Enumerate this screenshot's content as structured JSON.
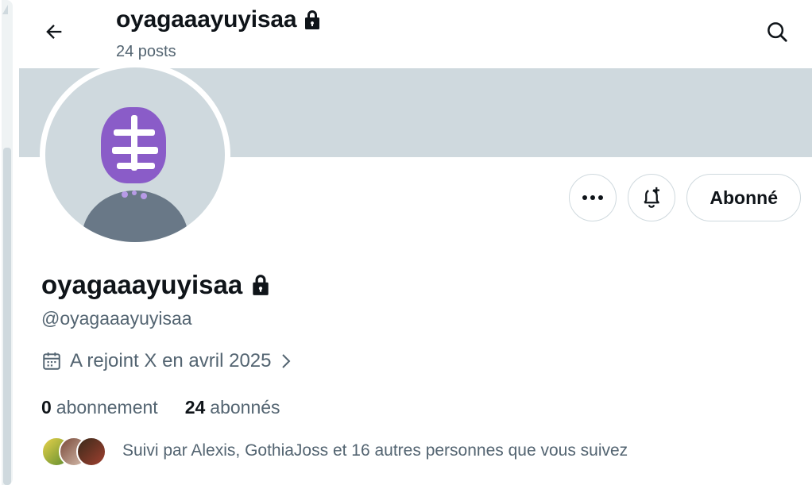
{
  "header": {
    "title": "oyagaaayuyisaa",
    "posts_count": "24 posts"
  },
  "icons": {
    "back": "arrow-left-icon",
    "search": "search-icon",
    "lock": "lock-icon",
    "more": "more-dots-icon",
    "notify": "bell-plus-icon",
    "calendar": "calendar-icon",
    "chevron": "chevron-right-icon"
  },
  "profile": {
    "display_name": "oyagaaayuyisaa",
    "handle": "@oyagaaayuyisaa",
    "joined": "A rejoint X en avril 2025",
    "following_count": "0",
    "following_label": "abonnement",
    "followers_count": "24",
    "followers_label": "abonnés",
    "followed_by": "Suivi par Alexis, GothiaJoss et 16 autres personnes que vous suivez"
  },
  "actions": {
    "follow_label": "Abonné"
  },
  "colors": {
    "banner": "#cfd9de",
    "text_primary": "#0f1419",
    "text_secondary": "#536471",
    "border": "#cfd9de",
    "avatar_accent": "#8a5cc8"
  }
}
